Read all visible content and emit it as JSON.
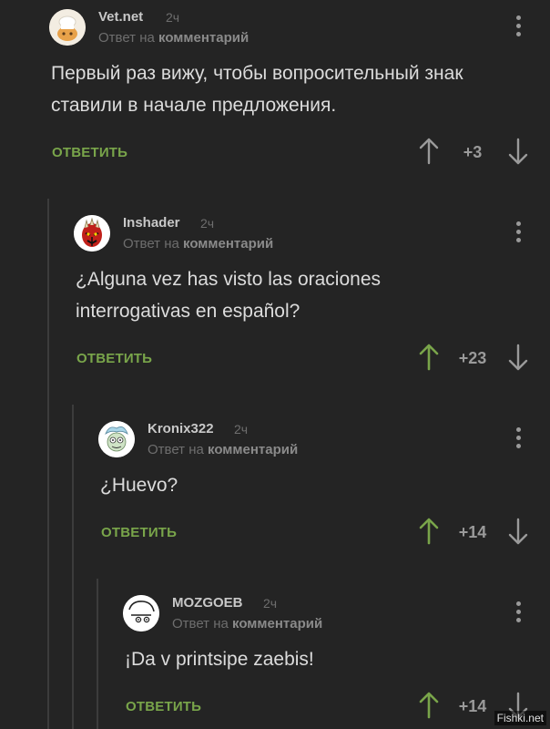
{
  "colors": {
    "background": "#242424",
    "accent_green": "#79a54a",
    "muted": "#6e6e6e",
    "thread_line": "#3c3c3c"
  },
  "comments": [
    {
      "author": "Vet.net",
      "time": "2ч",
      "reply_prefix": "Ответ на",
      "reply_target": "комментарий",
      "text_lines": [
        "Первый раз вижу, чтобы вопросительный знак",
        "ставили в начале предложения."
      ],
      "reply_label": "ОТВЕТИТЬ",
      "score": "+3",
      "upvoted": false,
      "avatar_icon": "chef-hat-avatar"
    },
    {
      "author": "Inshader",
      "time": "2ч",
      "reply_prefix": "Ответ на",
      "reply_target": "комментарий",
      "text_lines": [
        "¿Alguna vez has visto las oraciones",
        "interrogativas en español?"
      ],
      "reply_label": "ОТВЕТИТЬ",
      "score": "+23",
      "upvoted": true,
      "avatar_icon": "darth-maul-avatar"
    },
    {
      "author": "Kronix322",
      "time": "2ч",
      "reply_prefix": "Ответ на",
      "reply_target": "комментарий",
      "text_lines": [
        "¿Huevo?"
      ],
      "reply_label": "ОТВЕТИТЬ",
      "score": "+14",
      "upvoted": true,
      "avatar_icon": "cartoon-character-avatar"
    },
    {
      "author": "MOZGOEB",
      "time": "2ч",
      "reply_prefix": "Ответ на",
      "reply_target": "комментарий",
      "text_lines": [
        "¡Da v printsipe zaebis!"
      ],
      "reply_label": "ОТВЕТИТЬ",
      "score": "+14",
      "upvoted": true,
      "avatar_icon": "face-sketch-avatar"
    }
  ],
  "watermark": "Fishki.net"
}
